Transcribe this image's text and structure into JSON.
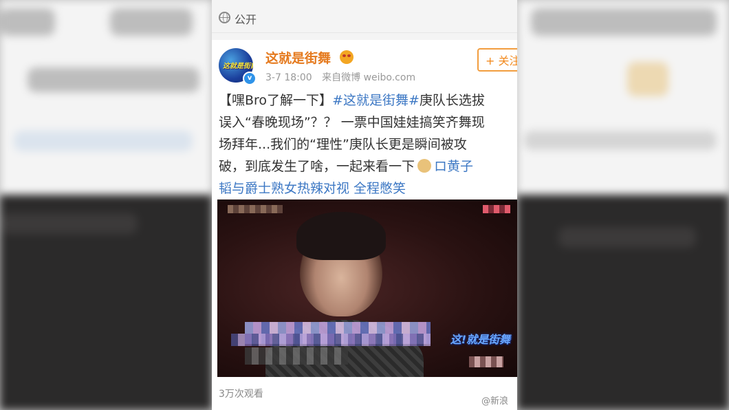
{
  "topbar": {
    "visibility_icon": "globe-icon",
    "visibility_label": "公开"
  },
  "post": {
    "username": "这就是街舞",
    "avatar_text": "这就是街舞",
    "date": "3-7 18:00",
    "source": "来自微博 weibo.com",
    "follow_label": "+ 关注",
    "text_lines": [
      {
        "parts": [
          {
            "t": "【嘿Bro了解一下】",
            "style": "normal"
          },
          {
            "t": "#这就是街舞#",
            "style": "topic"
          },
          {
            "t": "庚队长选拔",
            "style": "normal"
          }
        ]
      },
      {
        "parts": [
          {
            "t": "误入“春晚现场”？？ 一票中国娃娃搞笑齐舞现",
            "style": "normal"
          }
        ]
      },
      {
        "parts": [
          {
            "t": "场拜年...我们的“理性”庚队长更是瞬间被攻",
            "style": "normal"
          }
        ]
      },
      {
        "parts": [
          {
            "t": "破，到底发生了啥，一起来看一下",
            "style": "normal"
          },
          {
            "t": "",
            "style": "dog-icon"
          },
          {
            "t": "ロ黄子",
            "style": "link"
          }
        ]
      },
      {
        "parts": [
          {
            "t": "韬与爵士熟女热辣对视 全程憋笑",
            "style": "link"
          }
        ]
      }
    ],
    "video": {
      "show_logo": "这!就是街舞"
    },
    "view_count": "3万次观看"
  },
  "watermark": "@新浪"
}
